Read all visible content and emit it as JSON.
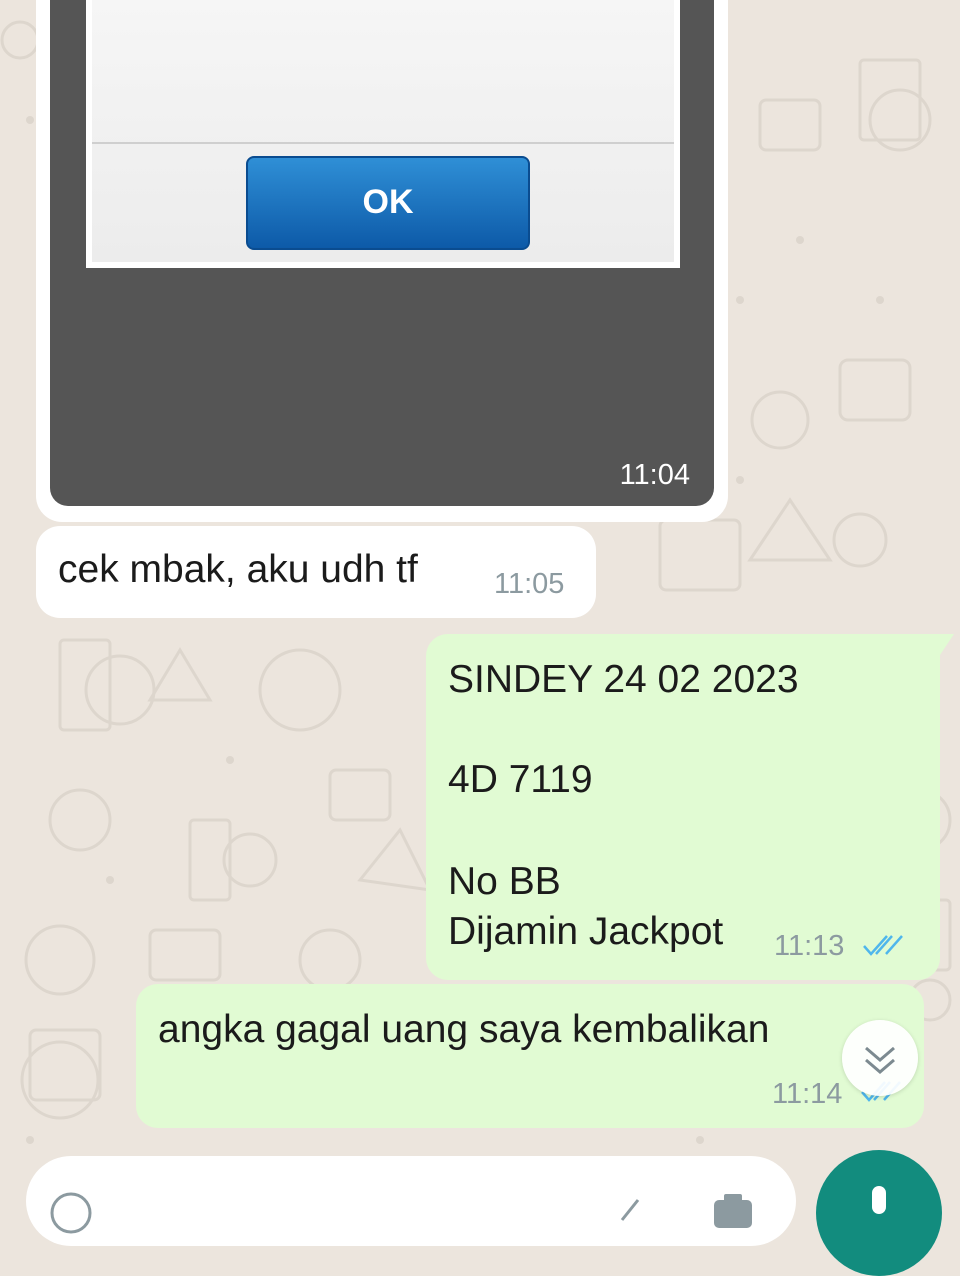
{
  "chat": {
    "image_message": {
      "dialog_button": "OK",
      "time": "11:04"
    },
    "message_1": {
      "text": "cek mbak, aku udh tf",
      "time": "11:05"
    },
    "message_2": {
      "lines": [
        "SINDEY 24 02 2023",
        "4D 7119",
        "No BB",
        "Dijamin Jackpot"
      ],
      "time": "11:13",
      "status": "read"
    },
    "message_3": {
      "text": "angka gagal uang saya kembalikan",
      "time": "11:14",
      "status": "read"
    }
  },
  "icons": {
    "read_receipt": "double-check-icon",
    "scroll_down": "chevron-double-down-icon",
    "emoji": "emoji-icon",
    "attach": "paperclip-icon",
    "camera": "camera-icon",
    "mic": "mic-icon"
  },
  "colors": {
    "background": "#ece5dd",
    "incoming": "#ffffff",
    "outgoing": "#e1fbd3",
    "read_tick": "#4fb6ec",
    "accent": "#128c7e"
  }
}
